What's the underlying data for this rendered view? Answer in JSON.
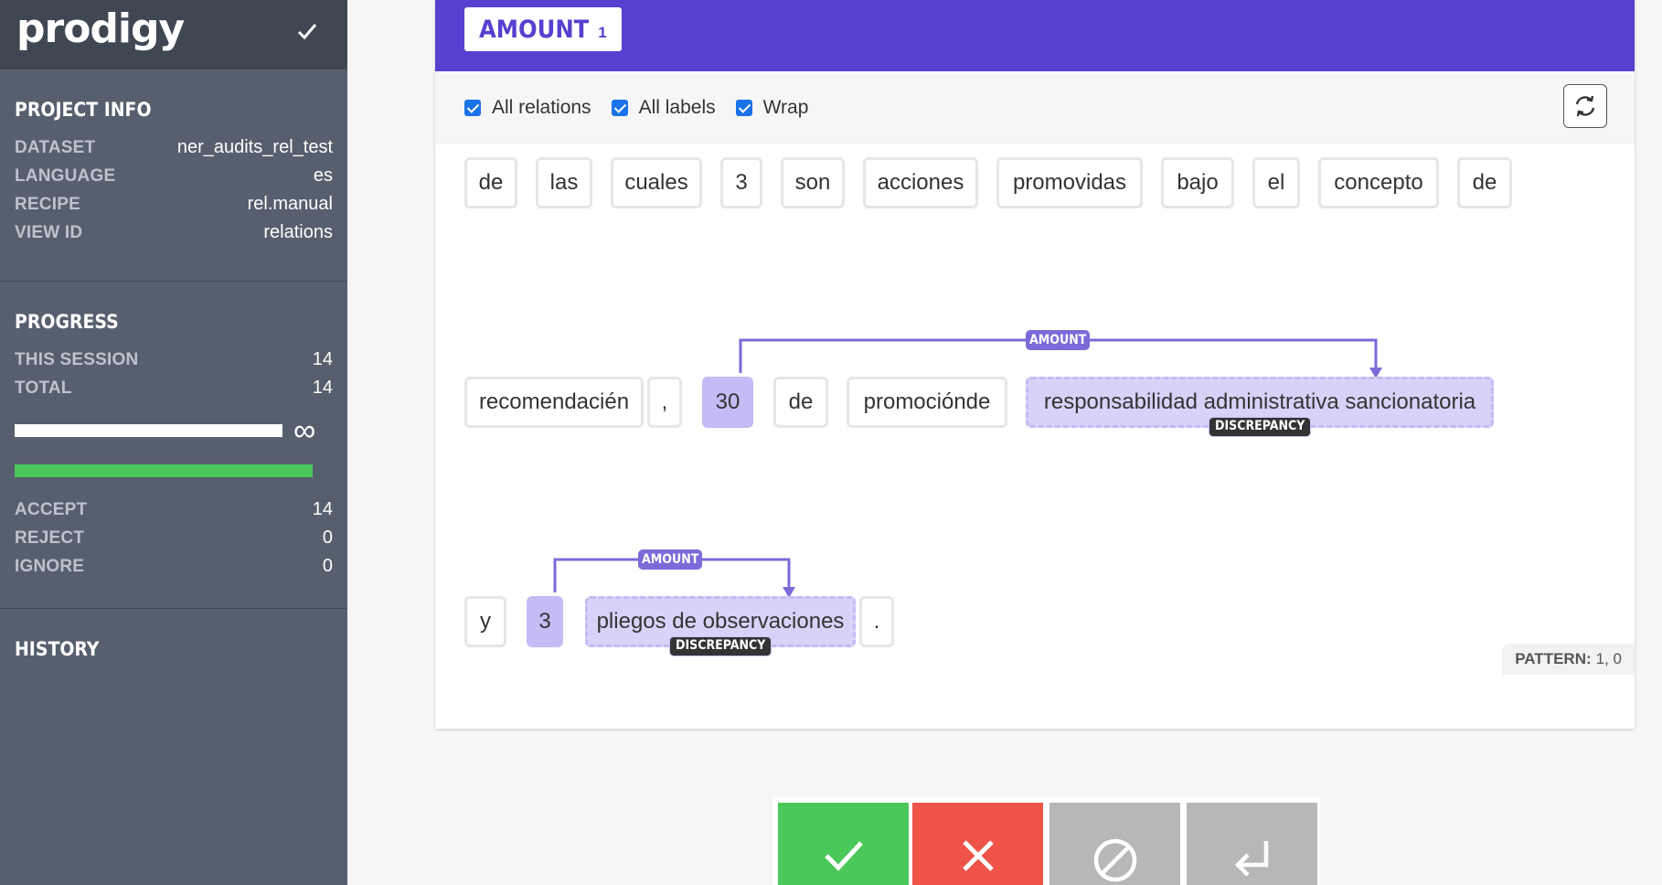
{
  "app": {
    "logo": "prodigy"
  },
  "project_info": {
    "title": "PROJECT INFO",
    "rows": [
      {
        "key": "DATASET",
        "value": "ner_audits_rel_test"
      },
      {
        "key": "LANGUAGE",
        "value": "es"
      },
      {
        "key": "RECIPE",
        "value": "rel.manual"
      },
      {
        "key": "VIEW ID",
        "value": "relations"
      }
    ]
  },
  "progress": {
    "title": "PROGRESS",
    "this_session_label": "THIS SESSION",
    "this_session": "14",
    "total_label": "TOTAL",
    "total": "14",
    "infinity": "∞",
    "accept_label": "ACCEPT",
    "accept": "14",
    "reject_label": "REJECT",
    "reject": "0",
    "ignore_label": "IGNORE",
    "ignore": "0"
  },
  "history": {
    "title": "HISTORY"
  },
  "header": {
    "label": "AMOUNT",
    "label_key": "1"
  },
  "toolbar": {
    "options": [
      {
        "label": "All relations",
        "checked": true
      },
      {
        "label": "All labels",
        "checked": true
      },
      {
        "label": "Wrap",
        "checked": true
      }
    ]
  },
  "tokens": [
    "de",
    "las",
    "cuales",
    "3",
    "son",
    "acciones",
    "promovidas",
    "bajo",
    "el",
    "concepto",
    "de",
    "recomendacién",
    ",",
    "30",
    "de",
    "promociónde",
    "responsabilidad administrativa sancionatoria",
    "y",
    "3",
    "pliegos de observaciones",
    "."
  ],
  "span_labels": {
    "span1": "DISCREPANCY",
    "span2": "DISCREPANCY"
  },
  "relations": {
    "rel1": "AMOUNT",
    "rel2": "AMOUNT"
  },
  "pattern": {
    "label": "PATTERN:",
    "value": "1, 0"
  },
  "colors": {
    "accent": "#583fcf",
    "accept": "#4bc85a",
    "reject": "#ef5448",
    "neutral": "#b7b7b7",
    "sidebar": "#565f6d"
  }
}
